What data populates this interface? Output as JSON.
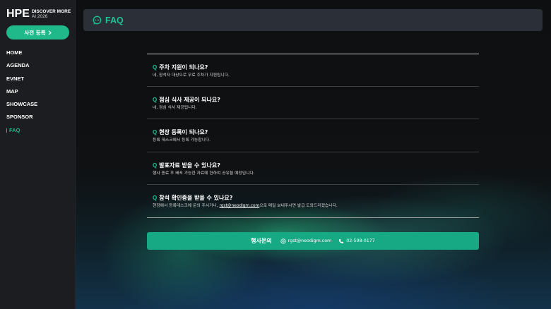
{
  "sidebar": {
    "logo": {
      "mark": "HPE",
      "tagline_1": "DISCOVER MORE",
      "tagline_2": "AI 2026"
    },
    "register_button": {
      "label": "사전 등록",
      "icon": "chevron-right-icon"
    },
    "nav": [
      {
        "label": "HOME"
      },
      {
        "label": "AGENDA"
      },
      {
        "label": "EVNET"
      },
      {
        "label": "MAP"
      },
      {
        "label": "SHOWCASE"
      },
      {
        "label": "SPONSOR"
      },
      {
        "label": "FAQ",
        "active": true
      }
    ]
  },
  "header": {
    "title": "FAQ",
    "icon": "chat-bubble-icon"
  },
  "faq": {
    "items": [
      {
        "q_mark": "Q",
        "question": "주차 지원이 되나요?",
        "answer": "네, 참석자 대상으로 무료 주차가 지원됩니다."
      },
      {
        "q_mark": "Q",
        "question": "점심 식사 제공이 되나요?",
        "answer": "네, 점심 식사 제공됩니다."
      },
      {
        "q_mark": "Q",
        "question": "현장 등록이 되나요?",
        "answer": "등록 데스크에서 등록 가능합니다."
      },
      {
        "q_mark": "Q",
        "question": "발표자료 받을 수 있나요?",
        "answer": "행사 종료 후 배포 가능한 자료에 한하여 공유될 예정입니다."
      },
      {
        "q_mark": "Q",
        "question": "참석 확인증을 받을 수 있나요?",
        "answer_prefix": "현장에서 등록데스크에 문의 주시거나, ",
        "answer_email": "rgst@neodigm.com",
        "answer_suffix": "으로 메일 보내주시면 발급 도와드리겠습니다."
      }
    ]
  },
  "contact": {
    "label": "행사문의",
    "email": "rgst@neodigm.com",
    "phone": "02-598-0177",
    "email_icon": "email-icon",
    "phone_icon": "phone-icon"
  },
  "colors": {
    "accent": "#1fc295",
    "button": "#1fb98a",
    "contact_bar": "#17a884",
    "sidebar_bg": "#1b1d20",
    "header_bg": "#2b3038"
  }
}
